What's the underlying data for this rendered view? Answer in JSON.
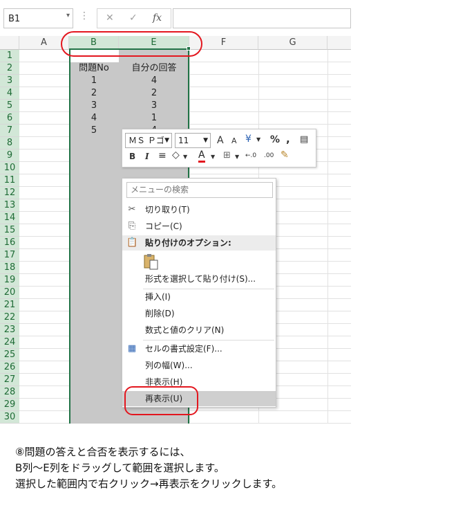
{
  "formula_bar": {
    "name_box": "B1",
    "name_box_dropdown": "▾",
    "separator": "⋮",
    "cancel_icon": "✕",
    "enter_icon": "✓",
    "fx": "fx",
    "formula": ""
  },
  "columns": [
    "A",
    "B",
    "E",
    "F",
    "G"
  ],
  "rows": [
    "1",
    "2",
    "3",
    "4",
    "5",
    "6",
    "7",
    "8",
    "9",
    "10",
    "11",
    "12",
    "13",
    "14",
    "15",
    "16",
    "17",
    "18",
    "19",
    "20",
    "21",
    "22",
    "23",
    "24",
    "25",
    "26",
    "27",
    "28",
    "29",
    "30"
  ],
  "sheet": {
    "header_b": "問題No",
    "header_e": "自分の回答",
    "b_values": [
      "1",
      "2",
      "3",
      "4",
      "5"
    ],
    "e_values": [
      "4",
      "2",
      "3",
      "1",
      "4"
    ]
  },
  "mini_toolbar": {
    "font_name": "ＭＳ Ｐゴ",
    "font_size": "11",
    "bold": "B",
    "italic": "I",
    "grow_font": "A",
    "shrink_font": "A",
    "percent": "%",
    "comma": ",",
    "font_color": "A",
    "decimal_more": "←.0",
    "decimal_less": ".00",
    "font_color_hex": "#e3161e"
  },
  "context_menu": {
    "search_placeholder": "メニューの検索",
    "items": {
      "cut": "切り取り(T)",
      "copy": "コピー(C)",
      "paste_options": "貼り付けのオプション:",
      "paste_special": "形式を選択して貼り付け(S)...",
      "insert": "挿入(I)",
      "delete": "削除(D)",
      "clear": "数式と値のクリア(N)",
      "format_cells": "セルの書式設定(F)...",
      "column_width": "列の幅(W)...",
      "hide": "非表示(H)",
      "unhide": "再表示(U)"
    }
  },
  "caption": {
    "line1": "⑧問題の答えと合否を表示するには、",
    "line2": "B列～E列をドラッグして範囲を選択します。",
    "line3": "選択した範囲内で右クリック→再表示をクリックします。"
  },
  "colors": {
    "accent_green": "#217346",
    "annotation_red": "#e3161e",
    "selection_gray": "#c8c8c8"
  }
}
